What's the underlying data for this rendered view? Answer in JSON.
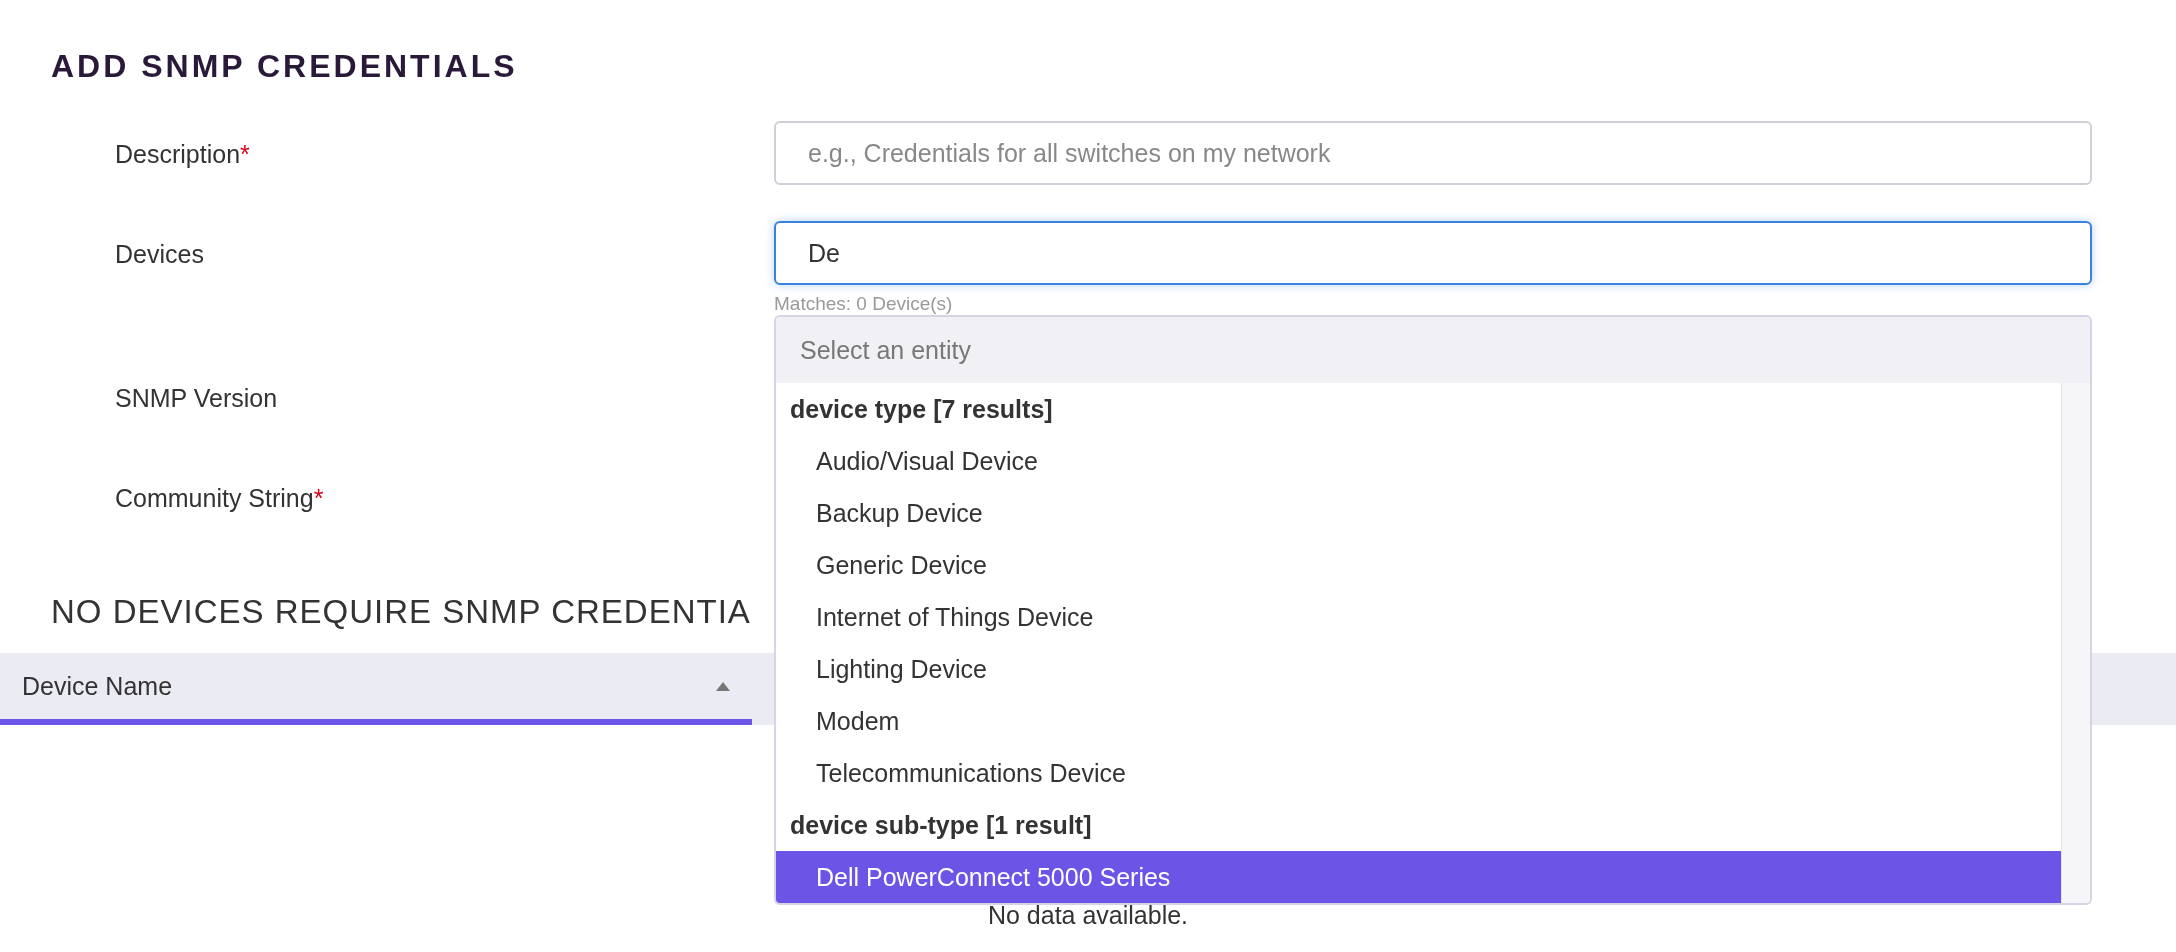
{
  "title": "ADD SNMP CREDENTIALS",
  "form": {
    "fields": [
      {
        "label": "Description",
        "required_mark": "*",
        "focused": false,
        "placeholder": "e.g., Credentials for all switches on my network"
      },
      {
        "label": "Devices",
        "focused": true,
        "value": "De",
        "hint": "Matches: 0 Device(s)"
      },
      {
        "label": "SNMP Version"
      },
      {
        "label": "Community String",
        "required_mark": "*"
      }
    ]
  },
  "dropdown": {
    "placeholder": "Select an entity",
    "groups": [
      {
        "heading": "device type [7 results]",
        "items": [
          {
            "label": "Audio/Visual Device",
            "selected": false
          },
          {
            "label": "Backup Device",
            "selected": false
          },
          {
            "label": "Generic Device",
            "selected": false
          },
          {
            "label": "Internet of Things Device",
            "selected": false
          },
          {
            "label": "Lighting Device",
            "selected": false
          },
          {
            "label": "Modem",
            "selected": false
          },
          {
            "label": "Telecommunications Device",
            "selected": false
          }
        ]
      },
      {
        "heading": "device sub-type [1 result]",
        "items": [
          {
            "label": "Dell PowerConnect 5000 Series",
            "selected": true
          }
        ]
      }
    ]
  },
  "section_heading": "NO DEVICES REQUIRE SNMP CREDENTIA",
  "table": {
    "columns": [
      {
        "label": "Device Name",
        "sorted": true
      }
    ],
    "empty_text": "No data available."
  }
}
